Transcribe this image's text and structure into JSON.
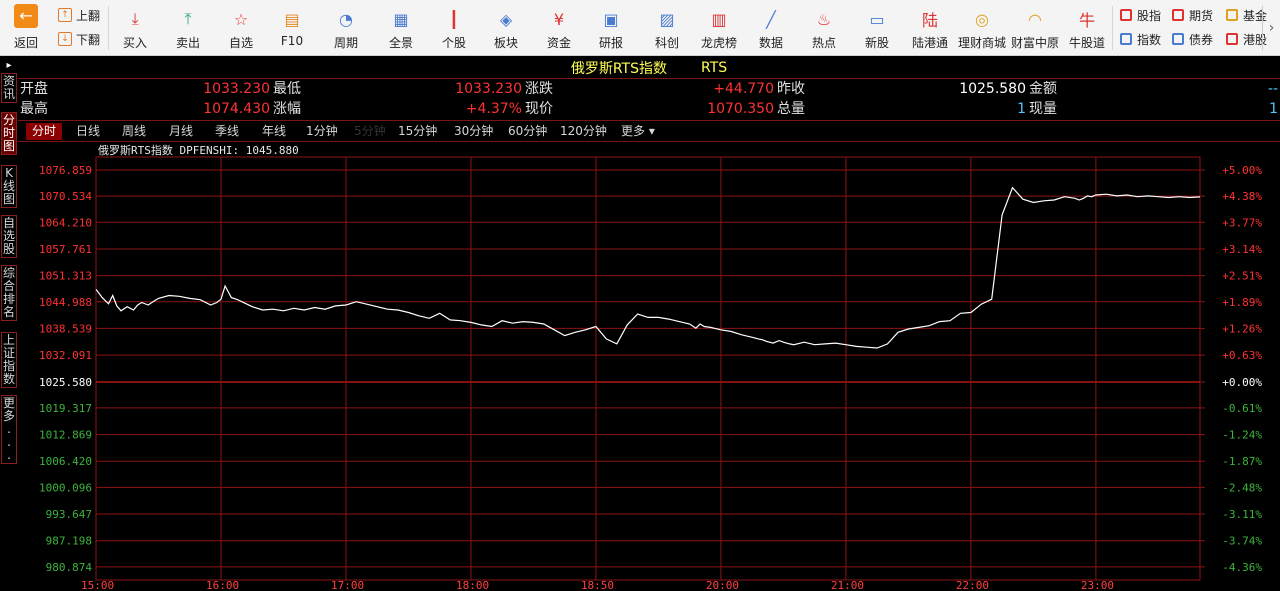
{
  "toolbar": {
    "back": "返回",
    "page_up": "上翻",
    "page_down": "下翻",
    "buttons": [
      "买入",
      "卖出",
      "自选",
      "F10",
      "周期",
      "全景",
      "个股",
      "板块",
      "资金",
      "研报",
      "科创",
      "龙虎榜",
      "数据",
      "热点",
      "新股",
      "陆港通",
      "理财商城",
      "财富中原",
      "牛股道"
    ],
    "right_links": [
      "股指",
      "期货",
      "基金",
      "指数",
      "债券",
      "港股"
    ]
  },
  "side_tabs": [
    "资讯",
    "分时图",
    "K线图",
    "自选股",
    "综合排名",
    "上证指数",
    "更多..."
  ],
  "title": {
    "name": "俄罗斯RTS指数",
    "code": "RTS"
  },
  "quote": {
    "open_label": "开盘",
    "open": "1033.230",
    "high_label": "最高",
    "high": "1074.430",
    "low_label": "最低",
    "low": "1033.230",
    "chg_pct_label": "涨幅",
    "chg_pct": "+4.37%",
    "chg_label": "涨跌",
    "chg": "+44.770",
    "price_label": "现价",
    "price": "1070.350",
    "prev_close_label": "昨收",
    "prev_close": "1025.580",
    "volume_label": "总量",
    "volume": "1",
    "amount_label": "金额",
    "amount": "--",
    "cur_vol_label": "现量",
    "cur_vol": "1"
  },
  "periods": [
    "分时",
    "日线",
    "周线",
    "月线",
    "季线",
    "年线",
    "1分钟",
    "5分钟",
    "15分钟",
    "30分钟",
    "60分钟",
    "120分钟",
    "更多"
  ],
  "active_period": "分时",
  "chart_data": {
    "type": "line",
    "title": "俄罗斯RTS指数 DPFENSHI: 1045.880",
    "prev_close": 1025.58,
    "ylim": [
      977.7,
      1080.0
    ],
    "y_ticks": [
      1076.859,
      1070.534,
      1064.21,
      1057.761,
      1051.313,
      1044.988,
      1038.539,
      1032.091,
      1025.58,
      1019.317,
      1012.869,
      1006.42,
      1000.096,
      993.647,
      987.198,
      980.874
    ],
    "y_tick_labels": [
      "1076.859",
      "1070.534",
      "1064.210",
      "1057.761",
      "1051.313",
      "1044.988",
      "1038.539",
      "1032.091",
      "1025.580",
      "1019.317",
      "1012.869",
      "1006.420",
      "1000.096",
      "993.647",
      "987.198",
      "980.874"
    ],
    "pct_labels": [
      "+5.00%",
      "+4.38%",
      "+3.77%",
      "+3.14%",
      "+2.51%",
      "+1.89%",
      "+1.26%",
      "+0.63%",
      "+0.00%",
      "-0.61%",
      "-1.24%",
      "-1.87%",
      "-2.48%",
      "-3.11%",
      "-3.74%",
      "-4.36%"
    ],
    "x_ticks": [
      "15:00",
      "16:00",
      "17:00",
      "18:00",
      "18:50",
      "20:00",
      "21:00",
      "22:00",
      "23:00"
    ],
    "x_range": [
      0,
      530
    ],
    "series": [
      {
        "x": [
          0,
          3,
          6,
          8,
          10,
          12,
          15,
          18,
          20,
          22,
          25,
          28,
          30,
          35,
          40,
          45,
          50,
          55,
          58,
          60,
          62,
          65,
          68,
          70,
          75,
          80,
          85,
          90,
          95,
          100,
          105,
          110,
          115,
          120,
          125,
          130,
          135,
          140,
          145,
          150,
          155,
          160,
          165,
          170,
          175,
          180,
          185,
          190,
          195,
          200,
          205,
          210,
          215,
          220,
          225,
          230,
          235,
          240,
          245,
          250,
          255,
          260,
          265,
          270,
          275,
          280,
          285,
          288,
          290,
          292,
          295,
          300,
          305,
          310,
          315,
          318,
          320,
          322,
          325,
          328,
          330,
          333,
          335,
          340,
          345,
          350,
          355,
          360,
          365,
          370,
          375,
          380,
          385,
          390,
          395,
          400,
          405,
          410,
          415,
          420,
          425,
          430,
          435,
          440,
          445,
          450,
          455,
          460,
          465,
          470,
          472,
          474,
          476,
          478,
          480,
          485,
          490,
          495,
          500,
          505,
          510,
          515,
          520,
          525,
          530
        ],
        "y": [
          1048.0,
          1046.0,
          1044.5,
          1046.5,
          1044.0,
          1042.8,
          1043.8,
          1043.0,
          1044.2,
          1044.8,
          1044.2,
          1045.2,
          1045.8,
          1046.5,
          1046.3,
          1045.8,
          1045.5,
          1044.2,
          1044.8,
          1045.6,
          1048.8,
          1046.0,
          1045.5,
          1045.0,
          1043.8,
          1043.0,
          1043.2,
          1042.8,
          1043.4,
          1043.0,
          1043.6,
          1043.2,
          1044.0,
          1044.2,
          1045.0,
          1044.4,
          1043.8,
          1043.2,
          1043.0,
          1042.4,
          1041.6,
          1041.0,
          1042.2,
          1040.6,
          1040.4,
          1040.0,
          1039.4,
          1039.0,
          1040.4,
          1039.8,
          1040.2,
          1040.0,
          1039.6,
          1038.2,
          1036.8,
          1037.6,
          1038.2,
          1039.0,
          1036.0,
          1034.8,
          1039.4,
          1042.0,
          1041.2,
          1041.2,
          1040.8,
          1040.2,
          1039.6,
          1038.6,
          1039.6,
          1039.0,
          1038.8,
          1038.2,
          1037.8,
          1037.0,
          1036.4,
          1036.0,
          1035.8,
          1035.4,
          1035.0,
          1035.6,
          1035.2,
          1034.8,
          1034.6,
          1035.2,
          1034.6,
          1034.8,
          1035.0,
          1034.6,
          1034.2,
          1034.0,
          1033.8,
          1034.8,
          1037.6,
          1038.4,
          1038.8,
          1039.2,
          1040.2,
          1040.4,
          1042.2,
          1042.4,
          1044.4,
          1045.6,
          1066.0,
          1072.6,
          1069.8,
          1069.0,
          1069.4,
          1069.6,
          1070.4,
          1070.0,
          1069.6,
          1070.0,
          1070.6,
          1070.4,
          1070.8,
          1071.0,
          1070.6,
          1070.8,
          1070.4,
          1070.6,
          1070.4,
          1070.2,
          1070.4,
          1070.2,
          1070.35
        ]
      }
    ],
    "colors": {
      "line": "#ffffff",
      "grid": "#8c1414",
      "up": "#ff3232",
      "down": "#3cb43c",
      "base": "#ffffff"
    }
  }
}
